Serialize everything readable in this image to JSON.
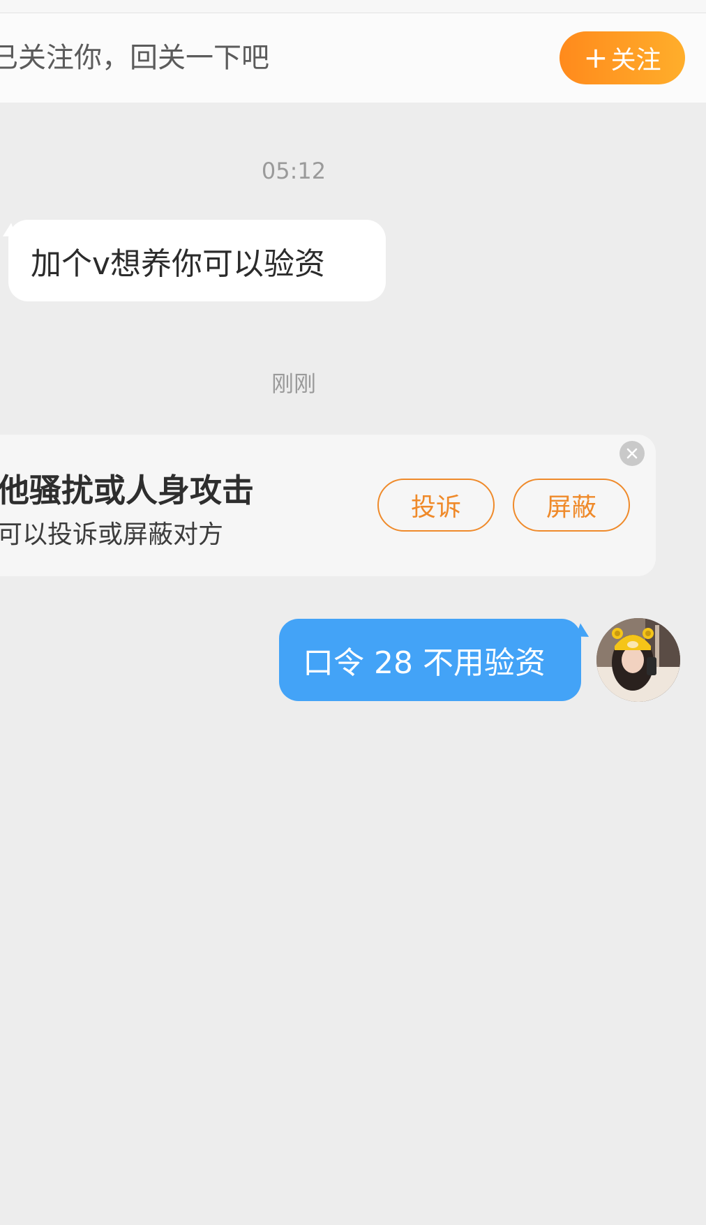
{
  "banner": {
    "text": "已关注你，回关一下吧",
    "follow_button": {
      "plus": "+",
      "label": "关注"
    }
  },
  "messages": [
    {
      "timestamp": "05:12",
      "direction": "incoming",
      "text": "加个v想养你可以验资"
    },
    {
      "timestamp": "刚刚",
      "direction": "outgoing",
      "text": "口令 28 不用验资"
    }
  ],
  "safety_notice": {
    "title": "他骚扰或人身攻击",
    "subtitle": "可以投诉或屏蔽对方",
    "report_label": "投诉",
    "block_label": "屏蔽"
  },
  "colors": {
    "accent_orange": "#ff8a1c",
    "outgoing_bubble": "#43a3f7",
    "background": "#ededed"
  },
  "icons": {
    "close": "close-icon",
    "plus": "plus-icon"
  }
}
